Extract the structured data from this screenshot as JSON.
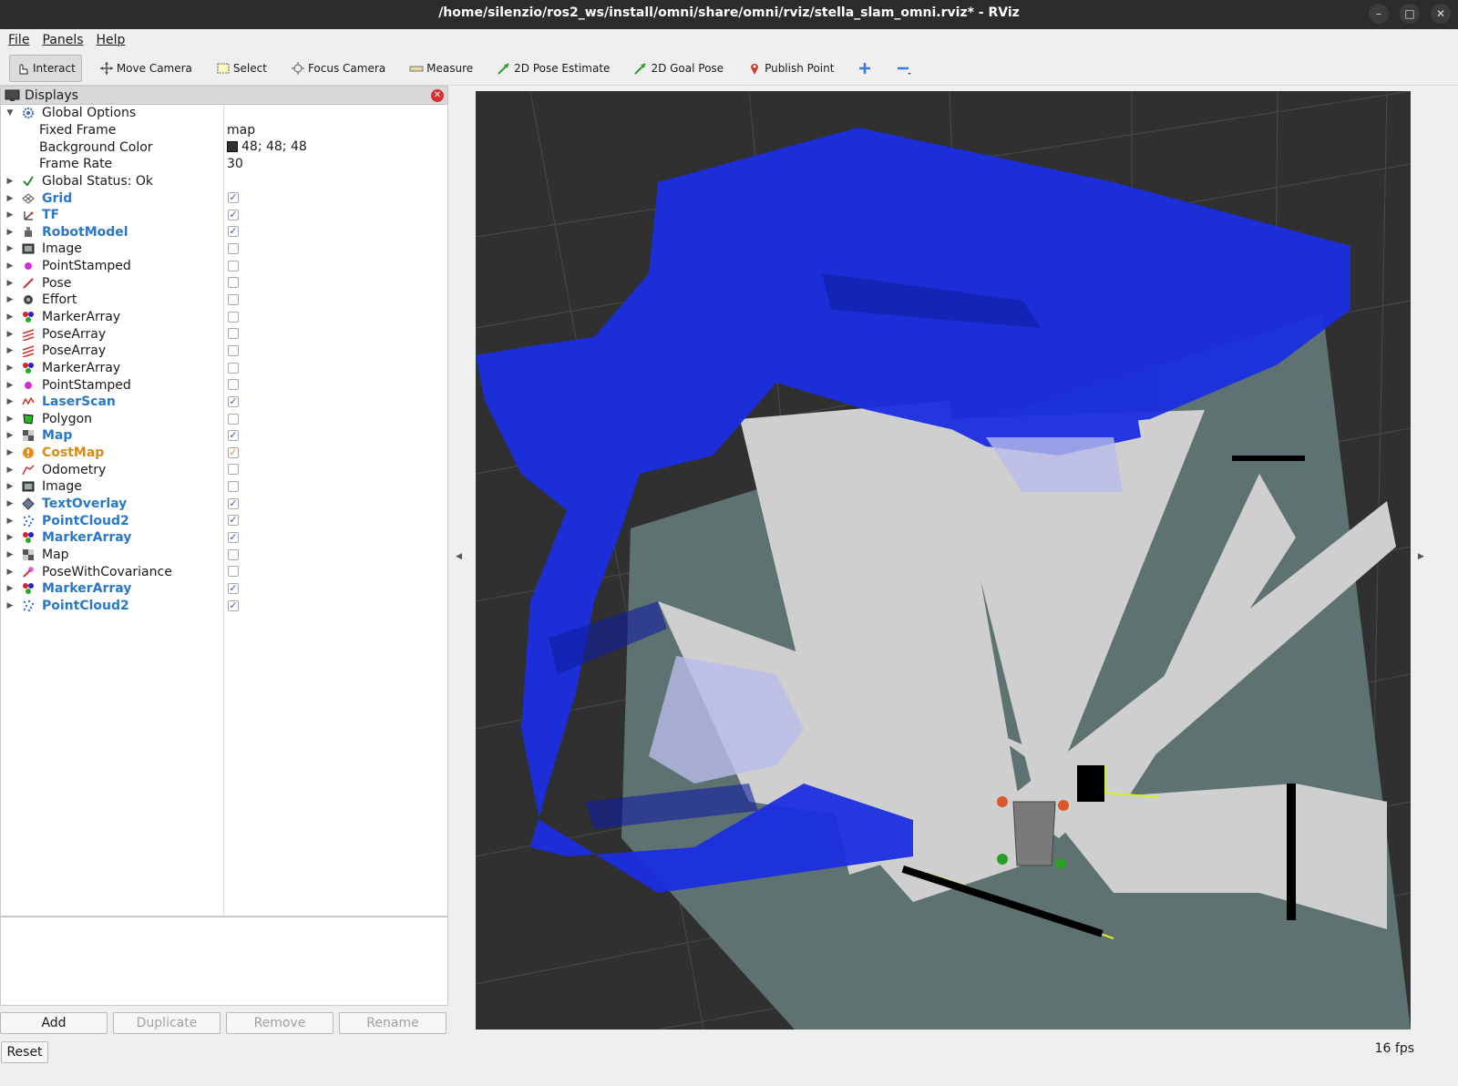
{
  "window": {
    "title": "/home/silenzio/ros2_ws/install/omni/share/omni/rviz/stella_slam_omni.rviz* - RViz"
  },
  "menu": {
    "file": "File",
    "panels": "Panels",
    "help": "Help"
  },
  "toolbar": {
    "interact": "Interact",
    "move_camera": "Move Camera",
    "select": "Select",
    "focus_camera": "Focus Camera",
    "measure": "Measure",
    "pose_estimate": "2D Pose Estimate",
    "goal_pose": "2D Goal Pose",
    "publish_point": "Publish Point"
  },
  "displays": {
    "title": "Displays",
    "global_options": "Global Options",
    "fixed_frame_label": "Fixed Frame",
    "fixed_frame_value": "map",
    "bg_color_label": "Background Color",
    "bg_color_value": "48; 48; 48",
    "frame_rate_label": "Frame Rate",
    "frame_rate_value": "30",
    "global_status": "Global Status: Ok",
    "items": [
      {
        "label": "Grid",
        "checked": true,
        "style": "enabled",
        "icon": "grid-icon"
      },
      {
        "label": "TF",
        "checked": true,
        "style": "enabled",
        "icon": "tf-icon"
      },
      {
        "label": "RobotModel",
        "checked": true,
        "style": "enabled",
        "icon": "robot-model-icon"
      },
      {
        "label": "Image",
        "checked": false,
        "style": "normal",
        "icon": "image-icon"
      },
      {
        "label": "PointStamped",
        "checked": false,
        "style": "normal",
        "icon": "point-icon"
      },
      {
        "label": "Pose",
        "checked": false,
        "style": "normal",
        "icon": "pose-icon"
      },
      {
        "label": "Effort",
        "checked": false,
        "style": "normal",
        "icon": "effort-icon"
      },
      {
        "label": "MarkerArray",
        "checked": false,
        "style": "normal",
        "icon": "marker-array-icon"
      },
      {
        "label": "PoseArray",
        "checked": false,
        "style": "normal",
        "icon": "pose-array-icon"
      },
      {
        "label": "PoseArray",
        "checked": false,
        "style": "normal",
        "icon": "pose-array-icon"
      },
      {
        "label": "MarkerArray",
        "checked": false,
        "style": "normal",
        "icon": "marker-array-icon"
      },
      {
        "label": "PointStamped",
        "checked": false,
        "style": "normal",
        "icon": "point-icon"
      },
      {
        "label": "LaserScan",
        "checked": true,
        "style": "enabled",
        "icon": "laser-scan-icon"
      },
      {
        "label": "Polygon",
        "checked": false,
        "style": "normal",
        "icon": "polygon-icon"
      },
      {
        "label": "Map",
        "checked": true,
        "style": "enabled",
        "icon": "map-icon"
      },
      {
        "label": "CostMap",
        "checked": true,
        "style": "warn",
        "icon": "warning-icon"
      },
      {
        "label": "Odometry",
        "checked": false,
        "style": "normal",
        "icon": "odometry-icon"
      },
      {
        "label": "Image",
        "checked": false,
        "style": "normal",
        "icon": "image-icon"
      },
      {
        "label": "TextOverlay",
        "checked": true,
        "style": "enabled",
        "icon": "text-overlay-icon"
      },
      {
        "label": "PointCloud2",
        "checked": true,
        "style": "enabled",
        "icon": "point-cloud-icon"
      },
      {
        "label": "MarkerArray",
        "checked": true,
        "style": "enabled",
        "icon": "marker-array-icon"
      },
      {
        "label": "Map",
        "checked": false,
        "style": "normal",
        "icon": "map-icon"
      },
      {
        "label": "PoseWithCovariance",
        "checked": false,
        "style": "normal",
        "icon": "pose-covariance-icon"
      },
      {
        "label": "MarkerArray",
        "checked": true,
        "style": "enabled",
        "icon": "marker-array-icon"
      },
      {
        "label": "PointCloud2",
        "checked": true,
        "style": "enabled",
        "icon": "point-cloud-icon"
      }
    ]
  },
  "buttons": {
    "add": "Add",
    "duplicate": "Duplicate",
    "remove": "Remove",
    "rename": "Rename",
    "reset": "Reset"
  },
  "status": {
    "fps": "16 fps"
  },
  "colors": {
    "view_background": "#303030",
    "voxel_blue": "#1a2ee0",
    "map_free": "#cfcfcf",
    "map_unknown": "#5f7272",
    "enabled_label": "#2a78c8",
    "warn_label": "#d88a1a"
  }
}
